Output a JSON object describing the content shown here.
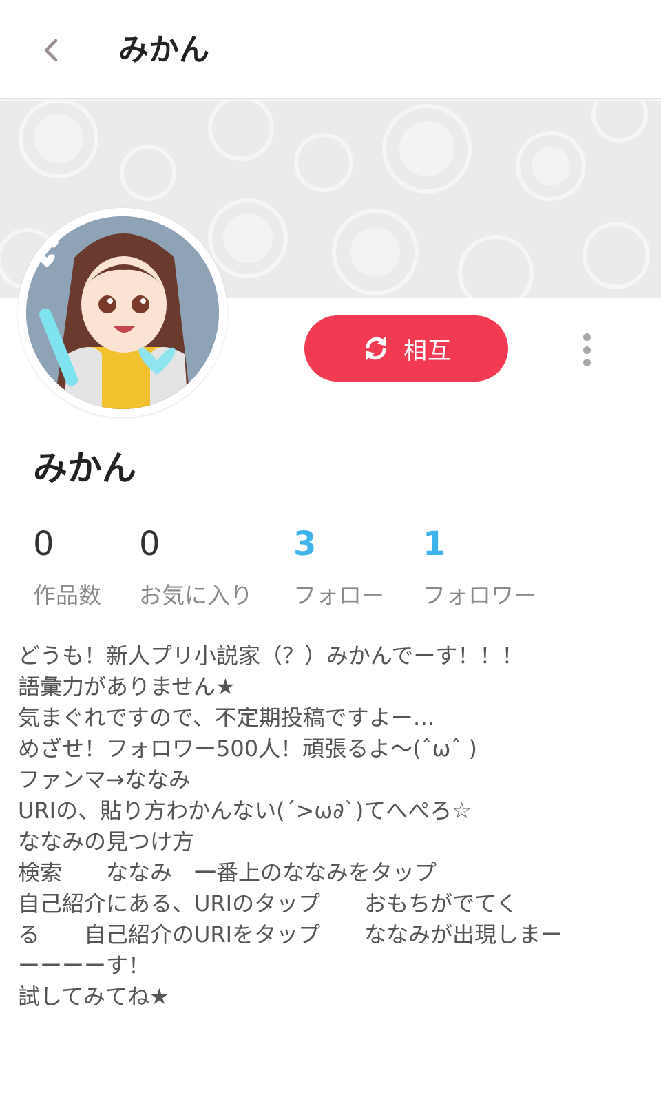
{
  "header": {
    "title": "みかん"
  },
  "profile": {
    "name": "みかん",
    "relation_label": "相互"
  },
  "stats": [
    {
      "value": "0",
      "label": "作品数"
    },
    {
      "value": "0",
      "label": "お気に入り"
    },
    {
      "value": "3",
      "label": "フォロー"
    },
    {
      "value": "1",
      "label": "フォロワー"
    }
  ],
  "bio": [
    "どうも！新人プリ小説家（？）みかんでーす！！！",
    "語彙力がありません★",
    "気まぐれですので、不定期投稿ですよー…",
    "めざせ！フォロワー500人！頑張るよ〜(ˆωˆ )",
    "ファンマ→ななみ",
    "URIの、貼り方わかんない(´>ω∂`)てへぺろ☆",
    "ななみの見つけ方",
    "検索　　ななみ　一番上のななみをタップ",
    "自己紹介にある、URIのタップ　　おもちがでてく",
    "る　　自己紹介のURIをタップ　　ななみが出現しまー",
    "ーーーーす！",
    "試してみてね★"
  ],
  "colors": {
    "accent": "#f23a52",
    "count_highlight": "#3fb4ea",
    "cover_bg": "#ebebeb"
  },
  "icons": {
    "back": "chevron-left-icon",
    "mutual": "refresh-icon",
    "more": "more-vertical-icon"
  }
}
